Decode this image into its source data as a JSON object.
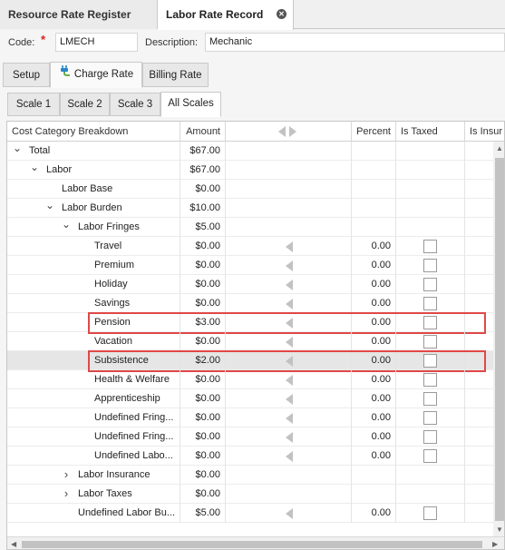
{
  "doc_tabs": [
    {
      "label": "Resource Rate Register"
    },
    {
      "label": "Labor Rate Record",
      "close_icon": "close-icon"
    }
  ],
  "form": {
    "code_label": "Code:",
    "required_mark": "*",
    "code_value": "LMECH",
    "description_label": "Description:",
    "description_value": "Mechanic"
  },
  "section_tabs": [
    {
      "label": "Setup"
    },
    {
      "label": "Charge Rate",
      "icon": "plug-icon",
      "active": true
    },
    {
      "label": "Billing Rate"
    }
  ],
  "scale_tabs": [
    {
      "label": "Scale 1"
    },
    {
      "label": "Scale 2"
    },
    {
      "label": "Scale 3"
    },
    {
      "label": "All Scales",
      "active": true
    }
  ],
  "grid": {
    "columns": {
      "name": "Cost Category Breakdown",
      "amount": "Amount",
      "percent": "Percent",
      "taxed": "Is Taxed",
      "insured": "Is Insur"
    },
    "rows": [
      {
        "name": "Total",
        "level": 0,
        "expander": "down",
        "amount": "$67.00",
        "arrow": false,
        "percent": "",
        "check": false
      },
      {
        "name": "Labor",
        "level": 1,
        "expander": "down",
        "amount": "$67.00",
        "arrow": false,
        "percent": "",
        "check": false
      },
      {
        "name": "Labor Base",
        "level": 2,
        "expander": "",
        "amount": "$0.00",
        "arrow": false,
        "percent": "",
        "check": false
      },
      {
        "name": "Labor Burden",
        "level": 2,
        "expander": "down",
        "amount": "$10.00",
        "arrow": false,
        "percent": "",
        "check": false
      },
      {
        "name": "Labor Fringes",
        "level": 3,
        "expander": "down",
        "amount": "$5.00",
        "arrow": false,
        "percent": "",
        "check": false
      },
      {
        "name": "Travel",
        "level": 4,
        "expander": "",
        "amount": "$0.00",
        "arrow": true,
        "percent": "0.00",
        "check": true
      },
      {
        "name": "Premium",
        "level": 4,
        "expander": "",
        "amount": "$0.00",
        "arrow": true,
        "percent": "0.00",
        "check": true
      },
      {
        "name": "Holiday",
        "level": 4,
        "expander": "",
        "amount": "$0.00",
        "arrow": true,
        "percent": "0.00",
        "check": true
      },
      {
        "name": "Savings",
        "level": 4,
        "expander": "",
        "amount": "$0.00",
        "arrow": true,
        "percent": "0.00",
        "check": true
      },
      {
        "name": "Pension",
        "level": 4,
        "expander": "",
        "amount": "$3.00",
        "arrow": true,
        "percent": "0.00",
        "check": true,
        "highlight": true
      },
      {
        "name": "Vacation",
        "level": 4,
        "expander": "",
        "amount": "$0.00",
        "arrow": true,
        "percent": "0.00",
        "check": true
      },
      {
        "name": "Subsistence",
        "level": 4,
        "expander": "",
        "amount": "$2.00",
        "arrow": true,
        "percent": "0.00",
        "check": true,
        "highlight": true,
        "selected": true
      },
      {
        "name": "Health & Welfare",
        "level": 4,
        "expander": "",
        "amount": "$0.00",
        "arrow": true,
        "percent": "0.00",
        "check": true
      },
      {
        "name": "Apprenticeship",
        "level": 4,
        "expander": "",
        "amount": "$0.00",
        "arrow": true,
        "percent": "0.00",
        "check": true
      },
      {
        "name": "Undefined Fring...",
        "level": 4,
        "expander": "",
        "amount": "$0.00",
        "arrow": true,
        "percent": "0.00",
        "check": true
      },
      {
        "name": "Undefined Fring...",
        "level": 4,
        "expander": "",
        "amount": "$0.00",
        "arrow": true,
        "percent": "0.00",
        "check": true
      },
      {
        "name": "Undefined Labo...",
        "level": 4,
        "expander": "",
        "amount": "$0.00",
        "arrow": true,
        "percent": "0.00",
        "check": true
      },
      {
        "name": "Labor Insurance",
        "level": 3,
        "expander": "right",
        "amount": "$0.00",
        "arrow": false,
        "percent": "",
        "check": false
      },
      {
        "name": "Labor Taxes",
        "level": 3,
        "expander": "right",
        "amount": "$0.00",
        "arrow": false,
        "percent": "",
        "check": false
      },
      {
        "name": "Undefined Labor Bu...",
        "level": 3,
        "expander": "",
        "amount": "$5.00",
        "arrow": true,
        "percent": "0.00",
        "check": true
      }
    ]
  },
  "colors": {
    "highlight": "#e04848",
    "selected_row": "#e6e6e6"
  }
}
